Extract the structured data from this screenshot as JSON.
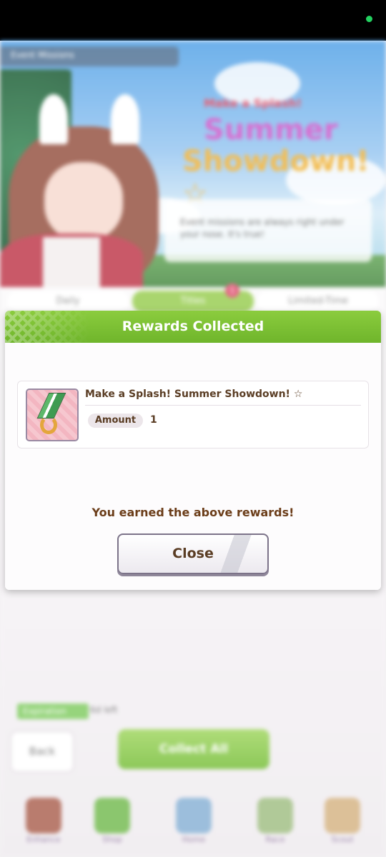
{
  "background": {
    "header_title": "Event Missions",
    "event_logo": {
      "line1": "Make a Splash!",
      "line2": "Summer",
      "line3": "Showdown!☆"
    },
    "speech_bubble": "Event missions are always right under your nose. It's true!",
    "tabs": [
      {
        "label": "Daily",
        "active": false
      },
      {
        "label": "Titles",
        "active": true,
        "badge": "1"
      },
      {
        "label": "Limited-Time",
        "active": false
      }
    ],
    "expiration_label": "Expiration",
    "expiration_value": "6d left",
    "back_label": "Back",
    "collect_all_label": "Collect All",
    "nav": [
      {
        "label": "Enhance",
        "icon": "character-icon"
      },
      {
        "label": "Shop",
        "icon": "shop-icon"
      },
      {
        "label": "Home",
        "icon": "home-icon"
      },
      {
        "label": "Race",
        "icon": "race-icon"
      },
      {
        "label": "Scout",
        "icon": "scout-icon"
      }
    ]
  },
  "dialog": {
    "title": "Rewards Collected",
    "reward": {
      "name": "Make a Splash! Summer Showdown! ☆",
      "amount_label": "Amount",
      "amount_value": "1",
      "icon": "horseshoe-ribbon-icon"
    },
    "message": "You earned the above rewards!",
    "close_label": "Close"
  },
  "colors": {
    "header_green": "#7cc142",
    "text_brown": "#5a3d24",
    "status_dot": "#23d160"
  }
}
